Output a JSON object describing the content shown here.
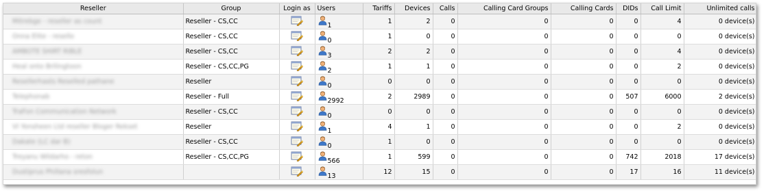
{
  "columns": {
    "reseller": "Reseller",
    "group": "Group",
    "login_as": "Login as",
    "users": "Users",
    "tariffs": "Tariffs",
    "devices": "Devices",
    "calls": "Calls",
    "calling_card_groups": "Calling Card Groups",
    "calling_cards": "Calling Cards",
    "dids": "DIDs",
    "call_limit": "Call Limit",
    "unlimited_calls": "Unlimited calls"
  },
  "rows": [
    {
      "reseller": "Mitrebge - reseller as count",
      "group": "Reseller - CS,CC",
      "users": "1",
      "tariffs": "1",
      "devices": "2",
      "calls": "0",
      "ccg": "0",
      "cc": "0",
      "dids": "0",
      "call_limit": "4",
      "unlimited": "0 device(s)"
    },
    {
      "reseller": "Onna Elite - resello",
      "group": "Reseller - CS,CC",
      "users": "0",
      "tariffs": "1",
      "devices": "0",
      "calls": "0",
      "ccg": "0",
      "cc": "0",
      "dids": "0",
      "call_limit": "0",
      "unlimited": "0 device(s)"
    },
    {
      "reseller": "AMBOTE SHIRT RIBLE",
      "group": "Reseller - CS,CC",
      "users": "3",
      "tariffs": "2",
      "devices": "2",
      "calls": "0",
      "ccg": "0",
      "cc": "0",
      "dids": "0",
      "call_limit": "4",
      "unlimited": "0 device(s)"
    },
    {
      "reseller": "Heal onto Brilingtoon",
      "group": "Reseller - CS,CC,PG",
      "users": "2",
      "tariffs": "1",
      "devices": "1",
      "calls": "0",
      "ccg": "0",
      "cc": "0",
      "dids": "0",
      "call_limit": "2",
      "unlimited": "0 device(s)"
    },
    {
      "reseller": "Resellerhasts Reselled pathane",
      "group": "Reseller",
      "users": "0",
      "tariffs": "0",
      "devices": "0",
      "calls": "0",
      "ccg": "0",
      "cc": "0",
      "dids": "0",
      "call_limit": "0",
      "unlimited": "0 device(s)"
    },
    {
      "reseller": "Telephonab",
      "group": "Reseller - Full",
      "users": "2992",
      "tariffs": "2",
      "devices": "2989",
      "calls": "0",
      "ccg": "0",
      "cc": "0",
      "dids": "507",
      "call_limit": "6000",
      "unlimited": "2 device(s)"
    },
    {
      "reseller": "TraFon Communication Network",
      "group": "Reseller - CS,CC",
      "users": "0",
      "tariffs": "0",
      "devices": "0",
      "calls": "0",
      "ccg": "0",
      "cc": "0",
      "dids": "0",
      "call_limit": "0",
      "unlimited": "0 device(s)"
    },
    {
      "reseller": "VI Yonsheen Ltd reseller Bloger Rekset",
      "group": "Reseller",
      "users": "1",
      "tariffs": "4",
      "devices": "1",
      "calls": "0",
      "ccg": "0",
      "cc": "0",
      "dids": "0",
      "call_limit": "2",
      "unlimited": "0 device(s)"
    },
    {
      "reseller": "Dakate (LC dar B)",
      "group": "Reseller - CS,CC",
      "users": "0",
      "tariffs": "1",
      "devices": "0",
      "calls": "0",
      "ccg": "0",
      "cc": "0",
      "dids": "0",
      "call_limit": "0",
      "unlimited": "0 device(s)"
    },
    {
      "reseller": "Treyanu Wildarho - reton",
      "group": "Reseller - CS,CC,PG",
      "users": "566",
      "tariffs": "1",
      "devices": "599",
      "calls": "0",
      "ccg": "0",
      "cc": "0",
      "dids": "742",
      "call_limit": "2018",
      "unlimited": "17 device(s)"
    },
    {
      "reseller": "Dustiprus Phillana sresfolun",
      "group": "",
      "users": "13",
      "tariffs": "12",
      "devices": "15",
      "calls": "0",
      "ccg": "0",
      "cc": "0",
      "dids": "17",
      "call_limit": "16",
      "unlimited": "11 device(s)"
    }
  ],
  "icons": {
    "login": "login-as-icon",
    "user": "user-icon"
  },
  "colors": {
    "header_bg": "#e9e9e9",
    "row_odd": "#f3f3f3",
    "row_even": "#ffffff"
  }
}
